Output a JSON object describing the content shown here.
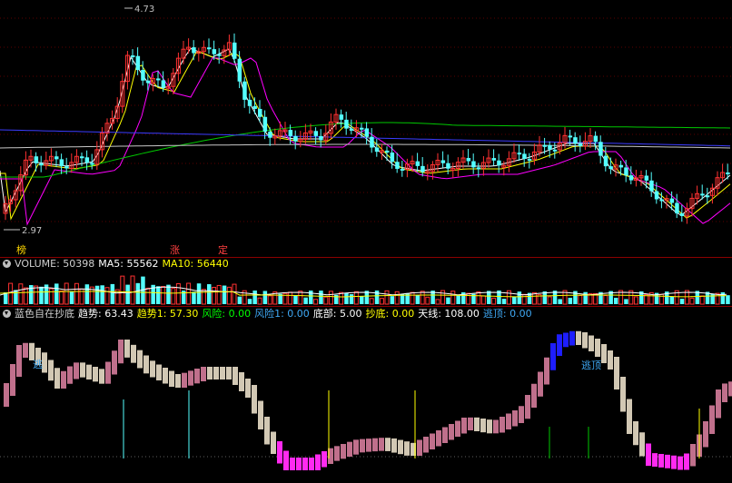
{
  "colors": {
    "up": "#ff3232",
    "down": "#54ffff",
    "ma5": "#ffffff",
    "ma10": "#ffff00",
    "ma20": "#ff00ff",
    "ma60": "#00c800",
    "ma120": "#3c3cff",
    "vol_ma5": "#ffffff",
    "vol_ma10": "#ffff00",
    "osc_up": "#c0708c",
    "osc_down": "#d2c8b4",
    "osc_blue": "#3fa9f5",
    "osc_magenta": "#ff2af0",
    "osc_deep_blue": "#1e1eff"
  },
  "price_panel": {
    "high_label": "4.73",
    "low_label": "2.97",
    "markers": [
      {
        "text": "榜",
        "color": "#ffd700"
      },
      {
        "text": "涨",
        "color": "#ff4040"
      },
      {
        "text": "定",
        "color": "#ff4040"
      }
    ]
  },
  "volume_header": {
    "name": "VOLUME: 50398",
    "ma5": "MA5: 55562",
    "ma10": "MA10: 56440"
  },
  "indicator_header": {
    "name": "蓝色自在抄底",
    "trend": "趋势: 63.43",
    "trend1": "趋势1: 57.30",
    "risk": "风险: 0.00",
    "risk1": "风险1: 0.00",
    "bottom": "底部: 5.00",
    "chaodi": "抄底: 0.00",
    "tianxian": "天线: 108.00",
    "escape": "逃顶: 0.00"
  },
  "indicator_labels": {
    "escape_left": "逃",
    "escape_right": "逃顶"
  }
}
